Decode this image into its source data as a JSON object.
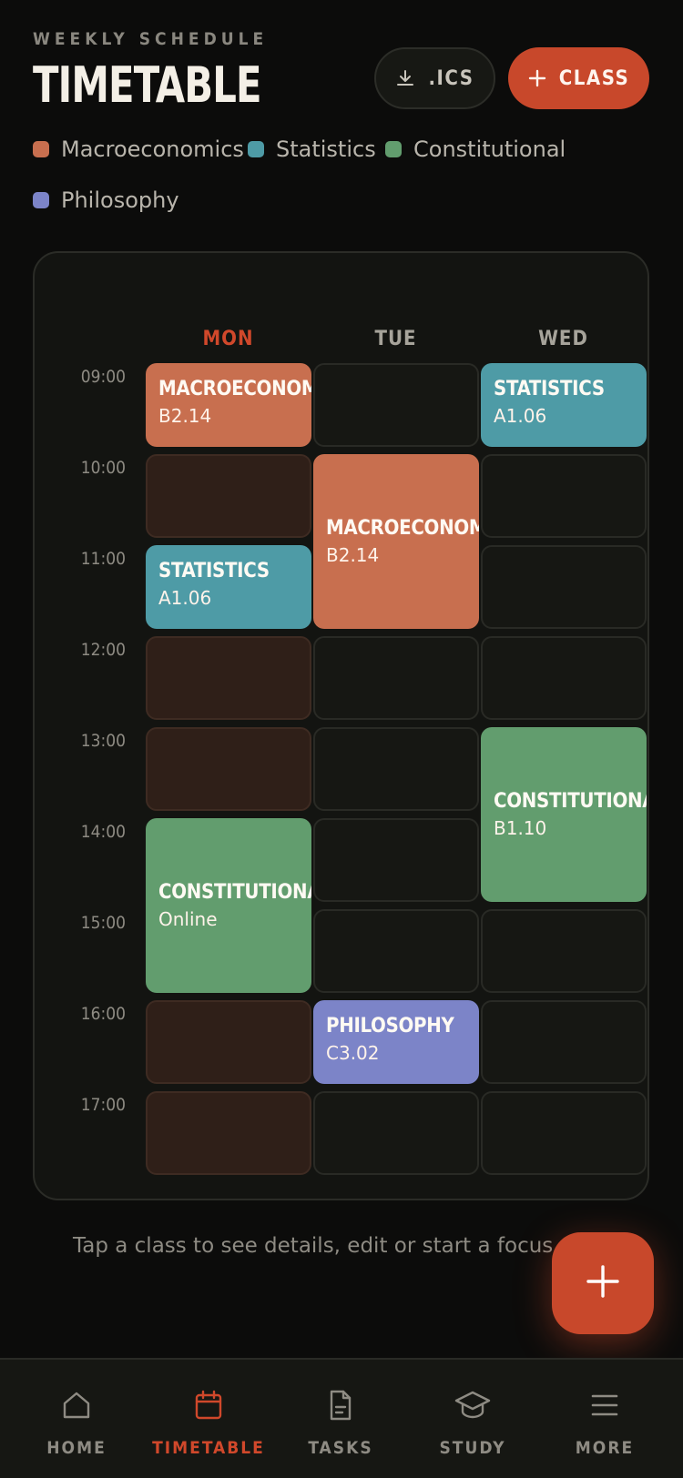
{
  "header": {
    "overline": "WEEKLY SCHEDULE",
    "title": "TIMETABLE",
    "ics_button": ".ICS",
    "class_button": "CLASS"
  },
  "legend": [
    {
      "label": "Macroeconomics",
      "color": "#c86f4f"
    },
    {
      "label": "Statistics",
      "color": "#4e9ba6"
    },
    {
      "label": "Constitutional",
      "color": "#629d6e"
    },
    {
      "label": "Philosophy",
      "color": "#7c84c8"
    }
  ],
  "days": [
    "MON",
    "TUE",
    "WED"
  ],
  "active_day": "MON",
  "times": [
    "09:00",
    "10:00",
    "11:00",
    "12:00",
    "13:00",
    "14:00",
    "15:00",
    "16:00",
    "17:00"
  ],
  "events": [
    {
      "day": 0,
      "start": 0,
      "span": 1,
      "name": "MACROECONOMICS",
      "room": "B2.14",
      "color": "#c86f4f"
    },
    {
      "day": 0,
      "start": 2,
      "span": 1,
      "name": "STATISTICS",
      "room": "A1.06",
      "color": "#4e9ba6"
    },
    {
      "day": 0,
      "start": 5,
      "span": 2,
      "name": "CONSTITUTIONAL",
      "room": "Online",
      "color": "#629d6e"
    },
    {
      "day": 1,
      "start": 1,
      "span": 2,
      "name": "MACROECONOMICS",
      "room": "B2.14",
      "color": "#c86f4f"
    },
    {
      "day": 1,
      "start": 7,
      "span": 1,
      "name": "PHILOSOPHY",
      "room": "C3.02",
      "color": "#7c84c8"
    },
    {
      "day": 2,
      "start": 0,
      "span": 1,
      "name": "STATISTICS",
      "room": "A1.06",
      "color": "#4e9ba6"
    },
    {
      "day": 2,
      "start": 4,
      "span": 2,
      "name": "CONSTITUTIONAL",
      "room": "B1.10",
      "color": "#629d6e"
    }
  ],
  "hint": "Tap a class to see details, edit or start a focus session.",
  "nav": {
    "items": [
      {
        "label": "HOME",
        "icon": "home-icon"
      },
      {
        "label": "TIMETABLE",
        "icon": "calendar-icon",
        "active": true
      },
      {
        "label": "TASKS",
        "icon": "document-icon"
      },
      {
        "label": "STUDY",
        "icon": "graduation-cap-icon"
      },
      {
        "label": "MORE",
        "icon": "menu-icon"
      }
    ]
  },
  "colors": {
    "accent": "#c8482b",
    "background": "#0c0c0b"
  }
}
